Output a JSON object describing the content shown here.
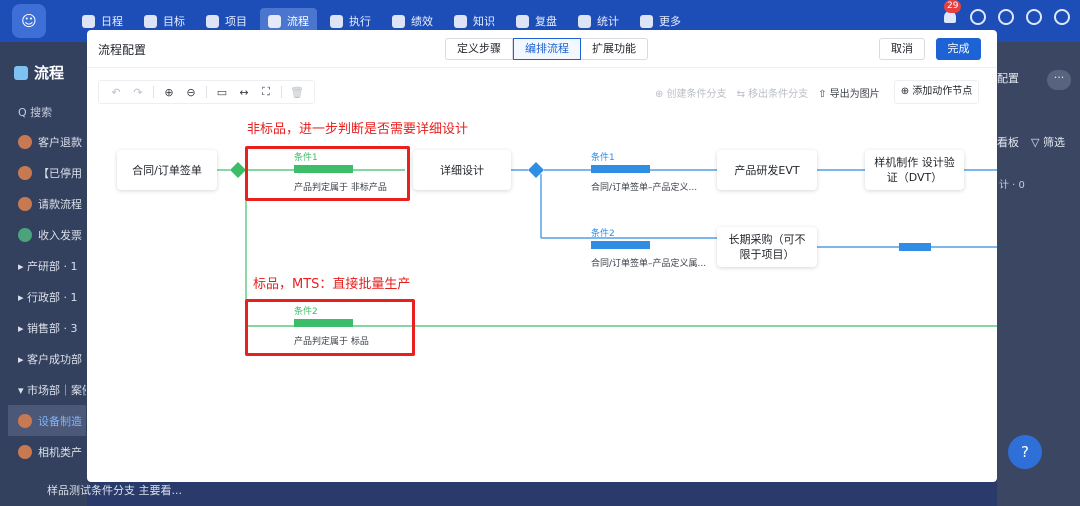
{
  "topbar": {
    "logo_glyph": "☺",
    "nav": [
      {
        "label": "日程",
        "icon": "calendar-icon"
      },
      {
        "label": "目标",
        "icon": "target-icon"
      },
      {
        "label": "项目",
        "icon": "cube-icon"
      },
      {
        "label": "流程",
        "icon": "flow-icon",
        "active": true
      },
      {
        "label": "执行",
        "icon": "list-icon"
      },
      {
        "label": "绩效",
        "icon": "chart-icon"
      },
      {
        "label": "知识",
        "icon": "book-icon"
      },
      {
        "label": "复盘",
        "icon": "review-icon"
      },
      {
        "label": "统计",
        "icon": "pie-icon"
      },
      {
        "label": "更多",
        "icon": "grid-icon"
      }
    ],
    "notification_count": "29"
  },
  "background": {
    "page_title": "流程",
    "search_placeholder": "Q 搜索",
    "sidebar": [
      "客户退款",
      "【已停用",
      "请款流程",
      "收入发票",
      "▸ 产研部 · 1",
      "▸ 行政部 · 1",
      "▸ 销售部 · 3",
      "▸ 客户成功部",
      "▾ 市场部｜案例",
      "设备制造",
      "相机类产",
      "样品测试条件分支 主要看..."
    ],
    "right_panel": {
      "config_label": "配置",
      "more_label": "···",
      "board_label": "看板",
      "filter_label": "▽ 筛选",
      "count_label": "计 · 0"
    }
  },
  "modal": {
    "title": "流程配置",
    "tabs": [
      "定义步骤",
      "编排流程",
      "扩展功能"
    ],
    "active_tab": 1,
    "cancel_label": "取消",
    "done_label": "完成",
    "toolbar": {
      "create_branch": "⊕ 创建条件分支",
      "remove_branch": "⇆ 移出条件分支",
      "export_image": "⇧ 导出为图片",
      "add_action": "⊕ 添加动作节点"
    }
  },
  "flow": {
    "nodes": {
      "contract": "合同/订单签单",
      "detail_design": "详细设计",
      "rd_evt": "产品研发EVT",
      "prototype": "样机制作 设计验证（DVT）",
      "long_purchase": "长期采购（可不限于项目）"
    },
    "conditions": {
      "c1_name": "条件1",
      "c1_desc": "产品判定属于 非标产品",
      "c2_name": "条件2",
      "c2_desc": "产品判定属于 标品",
      "d1_name": "条件1",
      "d1_desc": "合同/订单签单–产品定义...",
      "d2_name": "条件2",
      "d2_desc": "合同/订单签单–产品定义属..."
    },
    "colors": {
      "green": "#3dbd6a",
      "blue": "#2f8de4",
      "annotation": "#e8201e"
    }
  },
  "annotations": {
    "top": "非标品，进一步判断是否需要详细设计",
    "bottom": "标品，MTS：直接批量生产"
  }
}
